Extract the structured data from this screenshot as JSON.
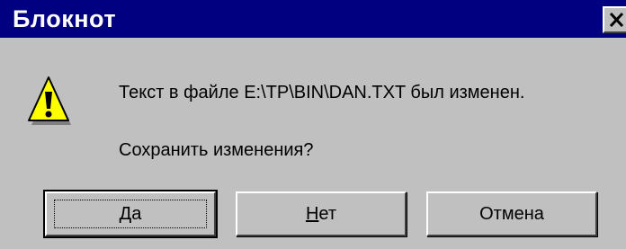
{
  "window": {
    "title": "Блокнот"
  },
  "dialog": {
    "icon": "warning-icon",
    "message_line1": "Текст в файле E:\\TP\\BIN\\DAN.TXT был изменен.",
    "message_line2": "Сохранить изменения?"
  },
  "buttons": {
    "yes": {
      "mnemonic": "Д",
      "rest": "а"
    },
    "no": {
      "mnemonic": "Н",
      "rest": "ет"
    },
    "cancel": {
      "label": "Отмена"
    }
  },
  "colors": {
    "titlebar": "#000080",
    "face": "#c0c0c0",
    "warning": "#ffff00"
  }
}
